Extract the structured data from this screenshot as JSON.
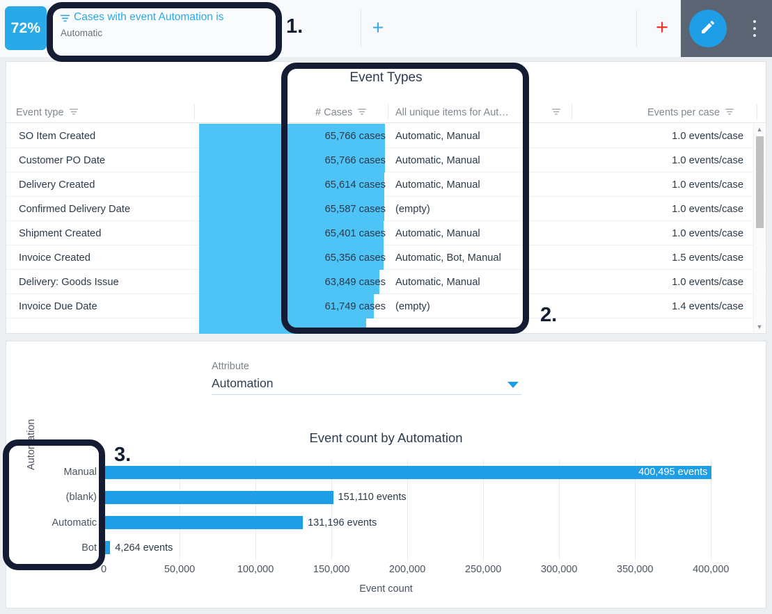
{
  "topbar": {
    "kpi_value": "72%",
    "filter_icon": "filter-icon",
    "filter_title": "Cases with event Automation is",
    "filter_value": "Automatic",
    "add_filter_label": "+",
    "add_component_label": "+",
    "edit_icon": "pencil-icon",
    "more_icon": "kebab-menu-icon"
  },
  "table": {
    "title": "Event Types",
    "columns": [
      {
        "label": "Event type",
        "filter_icon": "filter-icon"
      },
      {
        "label": "# Cases",
        "filter_icon": "filter-icon"
      },
      {
        "label": "All unique items for Aut…",
        "filter_icon": "filter-icon"
      },
      {
        "label": "Events per case",
        "filter_icon": "filter-icon"
      }
    ],
    "rows": [
      {
        "event_type": "SO Item Created",
        "cases": "65,766 cases",
        "items": "Automatic, Manual",
        "epc": "1.0 events/case",
        "bar_pct": 100.0
      },
      {
        "event_type": "Customer PO Date",
        "cases": "65,766 cases",
        "items": "Automatic, Manual",
        "epc": "1.0 events/case",
        "bar_pct": 100.0
      },
      {
        "event_type": "Delivery Created",
        "cases": "65,614 cases",
        "items": "Automatic, Manual",
        "epc": "1.0 events/case",
        "bar_pct": 99.8
      },
      {
        "event_type": "Confirmed Delivery Date",
        "cases": "65,587 cases",
        "items": "(empty)",
        "epc": "1.0 events/case",
        "bar_pct": 99.7
      },
      {
        "event_type": "Shipment Created",
        "cases": "65,401 cases",
        "items": "Automatic, Manual",
        "epc": "1.0 events/case",
        "bar_pct": 99.4
      },
      {
        "event_type": "Invoice Created",
        "cases": "65,356 cases",
        "items": "Automatic, Bot, Manual",
        "epc": "1.5 events/case",
        "bar_pct": 99.4
      },
      {
        "event_type": "Delivery: Goods Issue",
        "cases": "63,849 cases",
        "items": "Automatic, Manual",
        "epc": "1.0 events/case",
        "bar_pct": 97.1
      },
      {
        "event_type": "Invoice Due Date",
        "cases": "61,749 cases",
        "items": "(empty)",
        "epc": "1.4 events/case",
        "bar_pct": 93.9
      },
      {
        "event_type": "",
        "cases": "",
        "items": "",
        "epc": "",
        "bar_pct": 90.0
      }
    ],
    "scrollbar": {
      "up_icon": "scroll-up-arrow-icon",
      "down_icon": "scroll-down-arrow-icon"
    }
  },
  "chart_panel": {
    "attribute_label": "Attribute",
    "attribute_value": "Automation",
    "caret_icon": "chevron-down-icon"
  },
  "chart_data": {
    "type": "bar",
    "orientation": "horizontal",
    "title": "Event count by Automation",
    "xlabel": "Event count",
    "ylabel": "Automation",
    "categories": [
      "Manual",
      "(blank)",
      "Automatic",
      "Bot"
    ],
    "values": [
      400495,
      151110,
      131196,
      4264
    ],
    "value_labels": [
      "400,495 events",
      "151,110 events",
      "131,196 events",
      "4,264 events"
    ],
    "xlim": [
      0,
      415000
    ],
    "xticks": [
      0,
      50000,
      100000,
      150000,
      200000,
      250000,
      300000,
      350000,
      400000
    ],
    "xtick_labels": [
      "0",
      "50,000",
      "100,000",
      "150,000",
      "200,000",
      "250,000",
      "300,000",
      "350,000",
      "400,000"
    ],
    "grid": true,
    "legend": "none",
    "bar_color": "#1e9ee6"
  },
  "annotations": [
    {
      "number": "1."
    },
    {
      "number": "2."
    },
    {
      "number": "3."
    }
  ],
  "colors": {
    "accent_blue": "#29a9e8",
    "table_bar": "#4ec3f5",
    "chart_bar": "#1e9ee6",
    "annotation": "#131c33",
    "red_plus": "#f3352b"
  }
}
